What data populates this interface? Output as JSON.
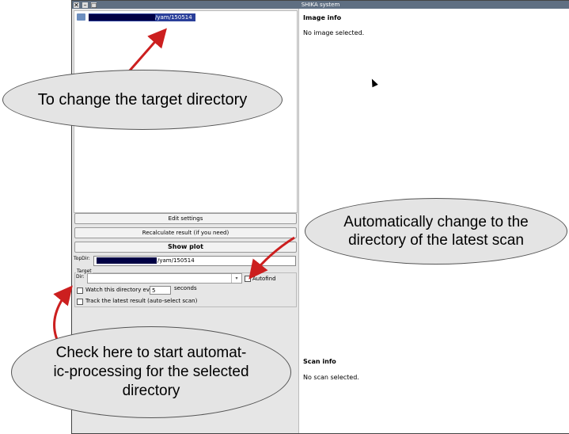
{
  "window": {
    "title": "SHIKA system"
  },
  "tree": {
    "selected_path_suffix": "/yam/150514"
  },
  "buttons": {
    "edit_settings": "Edit settings",
    "recalculate": "Recalculate result (if you need)",
    "show_plot": "Show plot"
  },
  "topdir": {
    "label": "TopDir:",
    "value_suffix": "/yam/150514"
  },
  "target": {
    "group_label": "Target",
    "dir_label": "Dir:",
    "autofind_label": "Autofind",
    "watch_label": "Watch this directory every",
    "watch_interval": "5",
    "watch_unit": "seconds",
    "track_label": "Track the latest result (auto-select scan)"
  },
  "image_info": {
    "title": "Image info",
    "message": "No image selected."
  },
  "scan_info": {
    "title": "Scan info",
    "message": "No scan selected."
  },
  "annotations": {
    "change_dir": "To change the target directory",
    "auto_change_line1": "Automatically change to the",
    "auto_change_line2": "directory of the latest scan",
    "check_line1": "Check here to start automat-",
    "check_line2": "ic-processing for the selected",
    "check_line3": "directory"
  }
}
